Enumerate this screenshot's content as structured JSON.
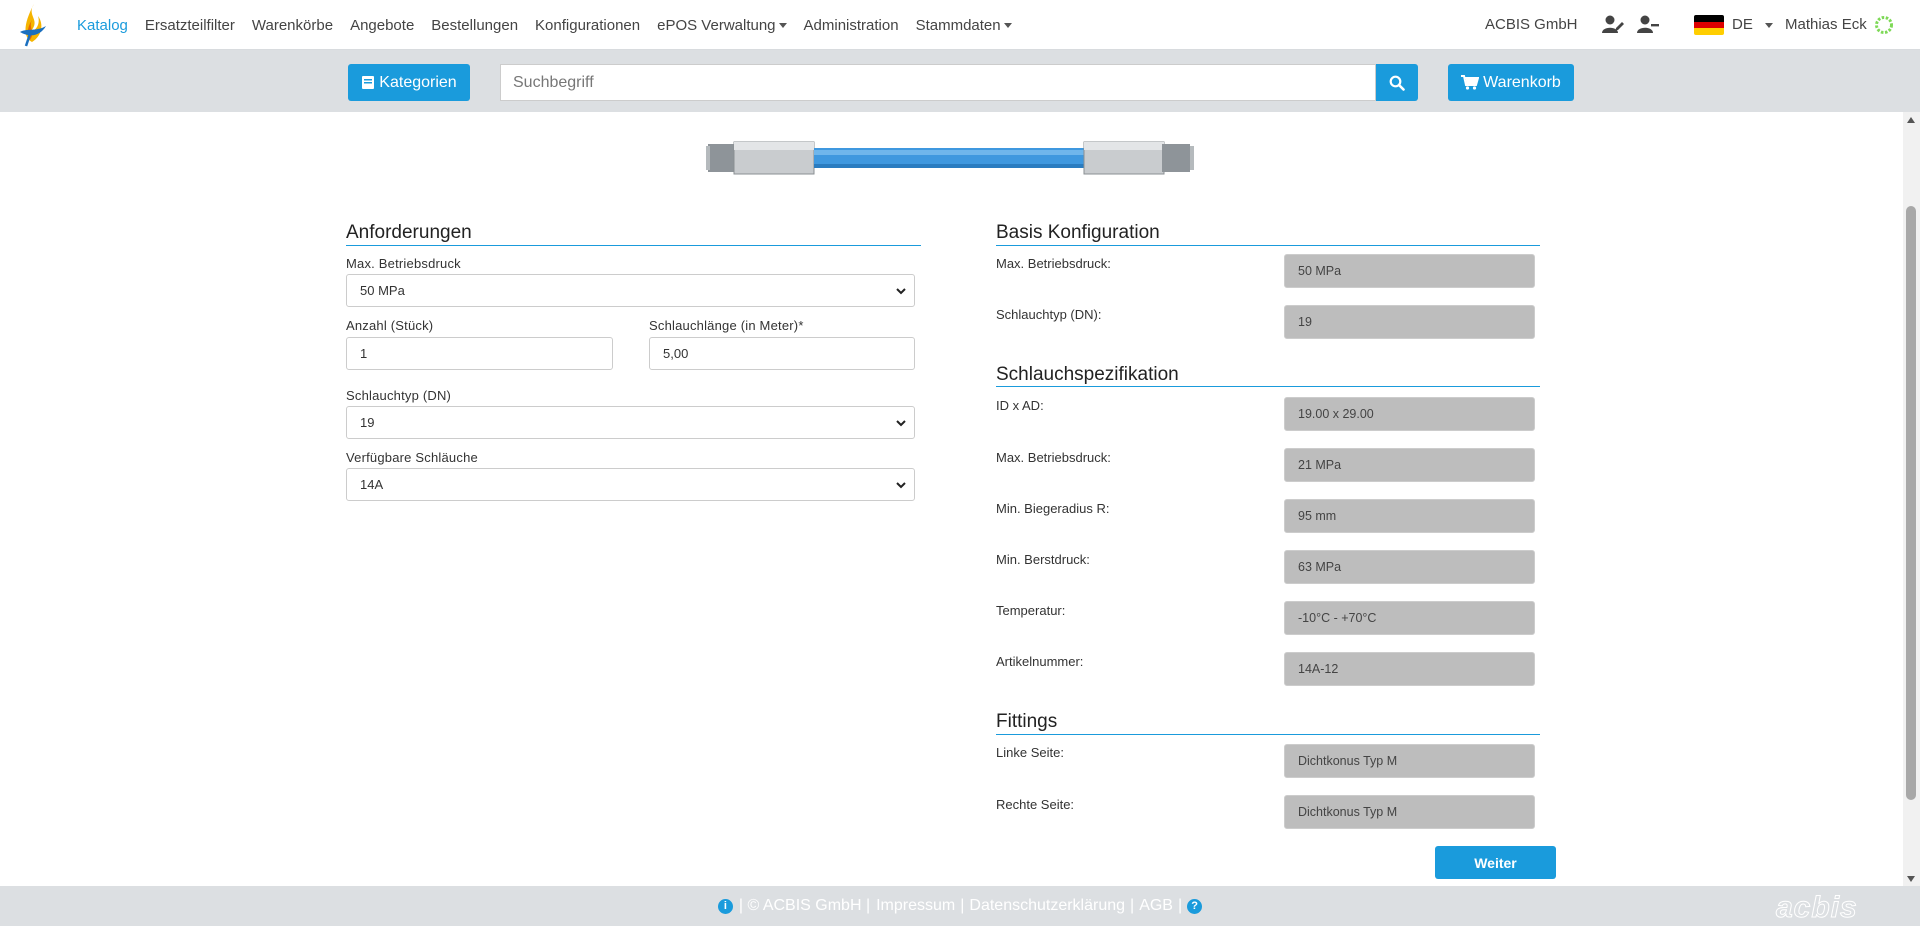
{
  "nav": {
    "items": [
      {
        "label": "Katalog",
        "active": true
      },
      {
        "label": "Ersatzteilfilter"
      },
      {
        "label": "Warenkörbe"
      },
      {
        "label": "Angebote"
      },
      {
        "label": "Bestellungen"
      },
      {
        "label": "Konfigurationen"
      },
      {
        "label": "ePOS Verwaltung",
        "dropdown": true
      },
      {
        "label": "Administration"
      },
      {
        "label": "Stammdaten",
        "dropdown": true
      }
    ],
    "company": "ACBIS GmbH",
    "language": "DE",
    "user": "Mathias Eck"
  },
  "searchbar": {
    "categories_label": "Kategorien",
    "search_placeholder": "Suchbegriff",
    "cart_label": "Warenkorb"
  },
  "requirements": {
    "title": "Anforderungen",
    "max_pressure_label": "Max. Betriebsdruck",
    "max_pressure_value": "50 MPa",
    "quantity_label": "Anzahl (Stück)",
    "quantity_value": "1",
    "length_label": "Schlauchlänge (in Meter)*",
    "length_value": "5,00",
    "hose_type_label": "Schlauchtyp (DN)",
    "hose_type_value": "19",
    "available_label": "Verfügbare Schläuche",
    "available_value": "14A"
  },
  "basis": {
    "title": "Basis Konfiguration",
    "rows": [
      {
        "label": "Max. Betriebsdruck:",
        "value": "50 MPa"
      },
      {
        "label": "Schlauchtyp (DN):",
        "value": "19"
      }
    ]
  },
  "spec": {
    "title": "Schlauchspezifikation",
    "rows": [
      {
        "label": "ID x AD:",
        "value": "19.00 x 29.00"
      },
      {
        "label": "Max. Betriebsdruck:",
        "value": "21 MPa"
      },
      {
        "label": "Min. Biegeradius R:",
        "value": "95 mm"
      },
      {
        "label": "Min. Berstdruck:",
        "value": "63 MPa"
      },
      {
        "label": "Temperatur:",
        "value": "-10°C - +70°C"
      },
      {
        "label": "Artikelnummer:",
        "value": "14A-12"
      }
    ]
  },
  "fittings": {
    "title": "Fittings",
    "rows": [
      {
        "label": "Linke Seite:",
        "value": "Dichtkonus Typ M"
      },
      {
        "label": "Rechte Seite:",
        "value": "Dichtkonus Typ M"
      }
    ]
  },
  "next_label": "Weiter",
  "footer": {
    "copyright": "| © ACBIS GmbH |",
    "impressum": "Impressum",
    "datenschutz": "Datenschutzerklärung",
    "agb": "AGB",
    "logo_text": "acbis"
  },
  "colors": {
    "accent": "#1a9bdc",
    "band": "#dcdfe2",
    "readonly": "#bdbdbd"
  }
}
